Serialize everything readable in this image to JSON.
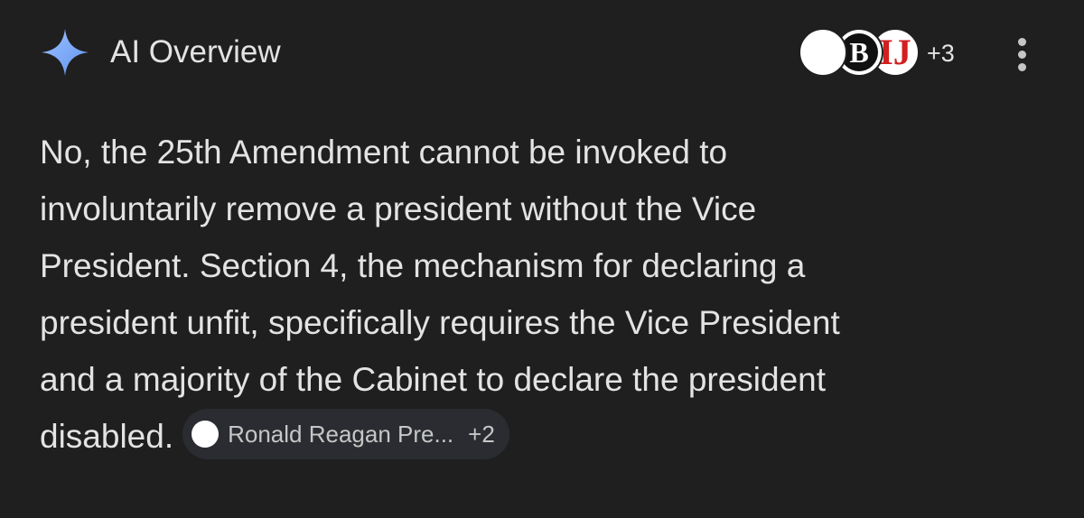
{
  "header": {
    "title": "AI Overview",
    "sparkle_icon": "gemini-sparkle-icon",
    "sources": {
      "avatars": [
        "",
        "B",
        "IJ"
      ],
      "more_count": "+3"
    },
    "menu_icon": "more-vert-icon"
  },
  "body": {
    "lines": [
      "No, the 25th Amendment cannot be invoked to",
      "involuntarily remove a president without the Vice",
      "President. Section 4, the mechanism for declaring a",
      "president unfit, specifically requires the Vice President",
      "and a majority of the Cabinet to declare the president",
      "disabled."
    ],
    "citation": {
      "label": "Ronald Reagan Pre...",
      "more_count": "+2"
    }
  },
  "colors": {
    "background": "#1f1f1f",
    "text": "#e3e3e3",
    "chip_background": "#2a2c31",
    "sparkle_blue": "#7baaf7",
    "logo_red": "#d21f1f"
  }
}
